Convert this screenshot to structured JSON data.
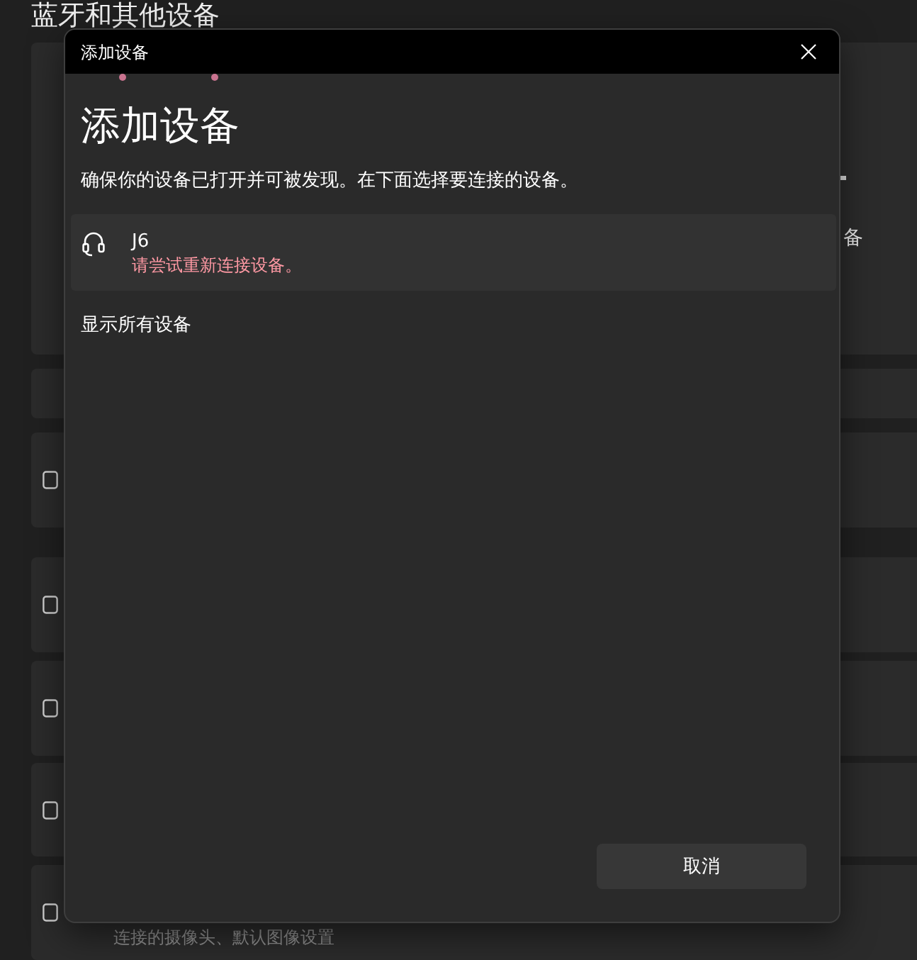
{
  "settings_page": {
    "title": "蓝牙和其他设备",
    "cards": [
      {
        "kind": "panel",
        "button_label": "备"
      },
      {
        "kind": "blank"
      },
      {
        "kind": "icon"
      },
      {
        "kind": "icon"
      },
      {
        "kind": "icon"
      },
      {
        "kind": "icon"
      },
      {
        "kind": "icon_text",
        "description": "连接的摄像头、默认图像设置"
      }
    ]
  },
  "dialog": {
    "title": "添加设备",
    "searching": true,
    "heading": "添加设备",
    "instruction": "确保你的设备已打开并可被发现。在下面选择要连接的设备。",
    "devices": [
      {
        "kind": "headset",
        "name": "J6",
        "status": "请尝试重新连接设备。",
        "status_error": true
      }
    ],
    "show_all": "显示所有设备",
    "cancel_button": "取消"
  }
}
